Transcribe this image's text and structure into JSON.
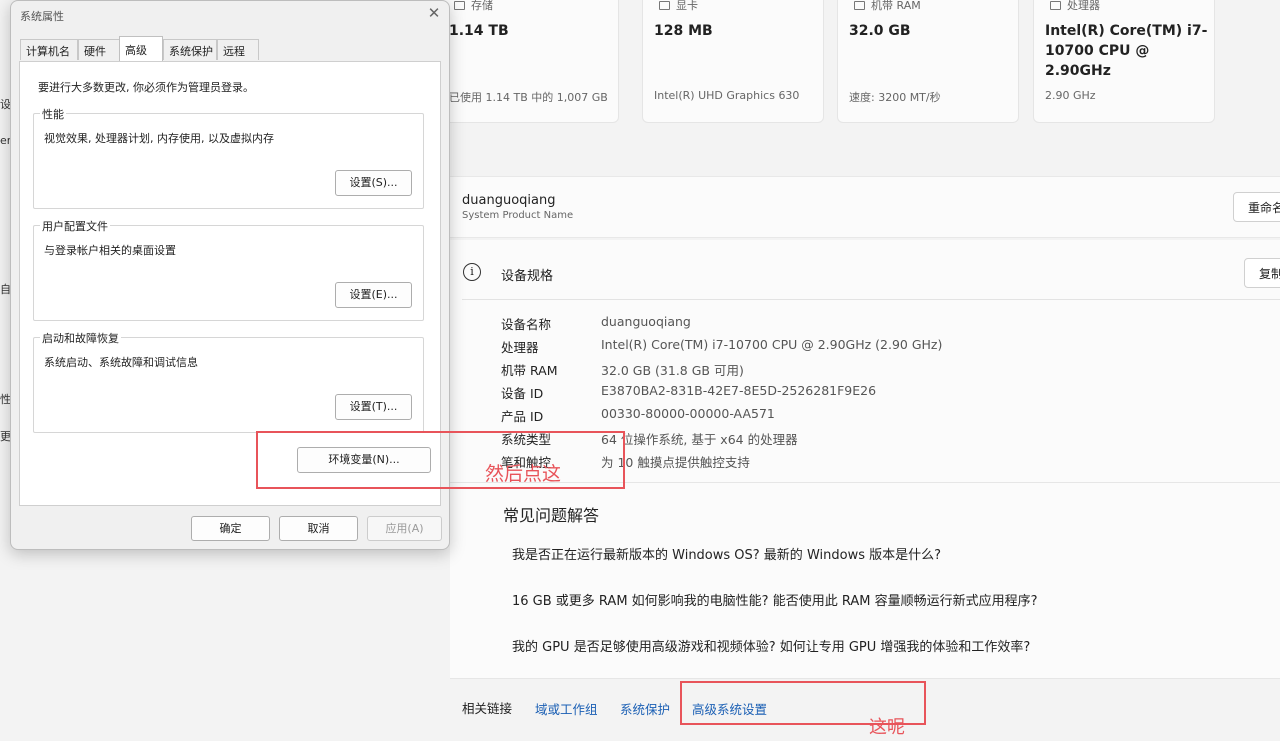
{
  "bg": {
    "left_edge": [
      "设",
      "er",
      "自",
      "性",
      "更"
    ],
    "cards": [
      {
        "caption": "存储",
        "value": "1.14 TB",
        "sub": "已使用 1.14 TB 中的 1,007 GB"
      },
      {
        "caption": "显卡",
        "value": "128 MB",
        "sub": "Intel(R) UHD Graphics 630"
      },
      {
        "caption": "机带 RAM",
        "value": "32.0 GB",
        "sub": "速度: 3200 MT/秒"
      },
      {
        "caption": "处理器",
        "value": "Intel(R) Core(TM) i7-10700 CPU @ 2.90GHz",
        "sub": "2.90 GHz"
      }
    ],
    "pc_name": "duanguoqiang",
    "pc_name_sub": "System Product Name",
    "rename_label": "重命名",
    "specs": {
      "heading": "设备规格",
      "copy_label": "复制",
      "rows": [
        {
          "k": "设备名称",
          "v": "duanguoqiang"
        },
        {
          "k": "处理器",
          "v": "Intel(R) Core(TM) i7-10700 CPU @ 2.90GHz (2.90 GHz)"
        },
        {
          "k": "机带 RAM",
          "v": "32.0 GB (31.8 GB 可用)"
        },
        {
          "k": "设备 ID",
          "v": "E3870BA2-831B-42E7-8E5D-2526281F9E26"
        },
        {
          "k": "产品 ID",
          "v": "00330-80000-00000-AA571"
        },
        {
          "k": "系统类型",
          "v": "64 位操作系统, 基于 x64 的处理器"
        },
        {
          "k": "笔和触控",
          "v": "为 10 触摸点提供触控支持"
        }
      ]
    },
    "faq": {
      "title": "常见问题解答",
      "questions": [
        "我是否正在运行最新版本的 Windows OS? 最新的 Windows 版本是什么?",
        "16 GB 或更多 RAM 如何影响我的电脑性能? 能否使用此 RAM 容量顺畅运行新式应用程序?",
        "我的 GPU 是否足够使用高级游戏和视频体验? 如何让专用 GPU 增强我的体验和工作效率?"
      ]
    },
    "links": {
      "label": "相关链接",
      "items": [
        "域或工作组",
        "系统保护",
        "高级系统设置"
      ]
    }
  },
  "annotations": {
    "env_note": "然后点这",
    "adv_note": "这呢"
  },
  "dialog": {
    "title": "系统属性",
    "tabs": [
      "计算机名",
      "硬件",
      "高级",
      "系统保护",
      "远程"
    ],
    "active_tab": "高级",
    "notice": "要进行大多数更改, 你必须作为管理员登录。",
    "groups": [
      {
        "label": "性能",
        "desc": "视觉效果, 处理器计划, 内存使用, 以及虚拟内存",
        "button": "设置(S)..."
      },
      {
        "label": "用户配置文件",
        "desc": "与登录帐户相关的桌面设置",
        "button": "设置(E)..."
      },
      {
        "label": "启动和故障恢复",
        "desc": "系统启动、系统故障和调试信息",
        "button": "设置(T)..."
      }
    ],
    "env_button": "环境变量(N)...",
    "ok": "确定",
    "cancel": "取消",
    "apply": "应用(A)"
  }
}
